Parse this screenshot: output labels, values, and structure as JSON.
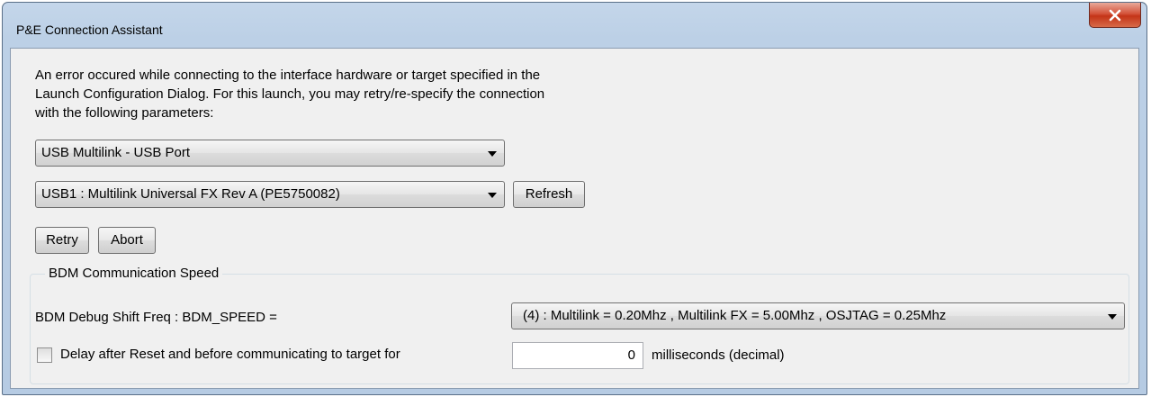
{
  "window": {
    "title": "P&E Connection Assistant",
    "close_glyph": "x"
  },
  "message": {
    "line1": "An error occured while connecting to the interface hardware or target specified in the",
    "line2": "Launch Configuration Dialog. For this launch, you may retry/re-specify the connection",
    "line3": "with the following parameters:"
  },
  "interface_select": {
    "value": "USB Multilink - USB Port"
  },
  "port_select": {
    "value": "USB1 : Multilink Universal FX Rev A (PE5750082)"
  },
  "buttons": {
    "refresh": "Refresh",
    "retry": "Retry",
    "abort": "Abort"
  },
  "bdm": {
    "group_title": "BDM Communication Speed",
    "shift_freq_label": "BDM Debug Shift Freq : BDM_SPEED =",
    "speed_value": "(4)  :  Multilink = 0.20Mhz  ,  Multilink FX =  5.00Mhz  ,  OSJTAG = 0.25Mhz",
    "delay_label": "Delay after Reset and before communicating to target for",
    "delay_checked": false,
    "delay_value": "0",
    "delay_units": "milliseconds (decimal)"
  }
}
